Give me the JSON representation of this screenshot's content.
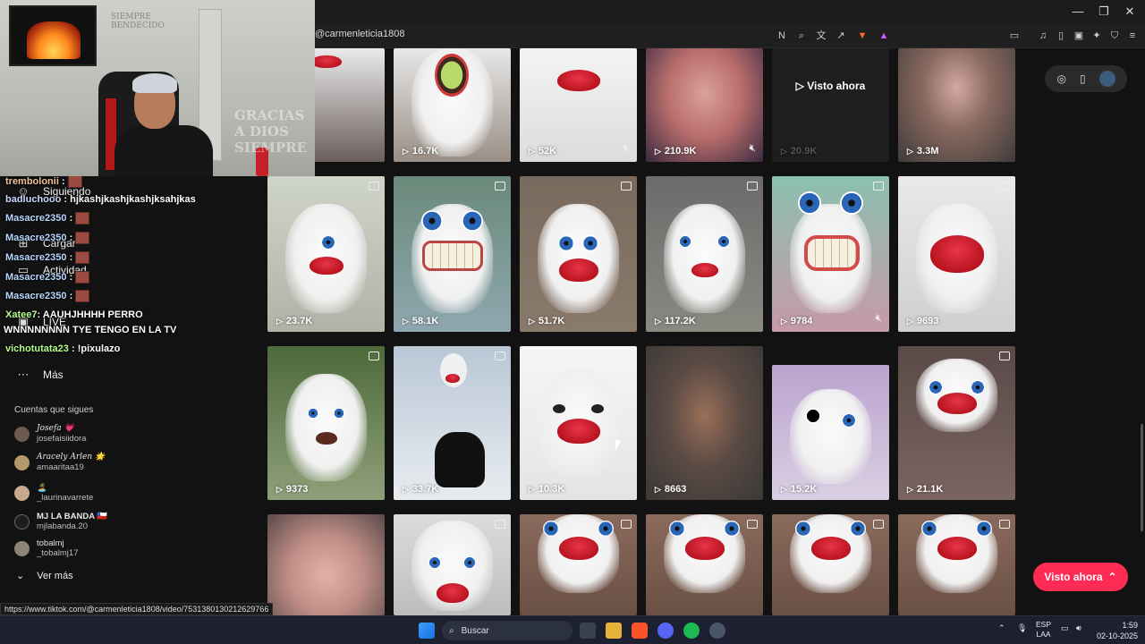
{
  "browser": {
    "url": "@carmenleticia1808",
    "status_url": "https://www.tiktok.com/@carmenleticia1808/video/7531380130212629766"
  },
  "sidebar": {
    "items": [
      {
        "label": "Siguiendo",
        "icon": "following-icon"
      },
      {
        "label": "Cargar",
        "icon": "upload-icon"
      },
      {
        "label": "Actividad",
        "icon": "activity-icon"
      },
      {
        "label": "LIVE",
        "icon": "live-icon"
      },
      {
        "label": "Más",
        "icon": "more-icon"
      }
    ],
    "follows_title": "Cuentas que sigues",
    "follows": [
      {
        "name": "Josefa 💗",
        "user": "josefaisiidora"
      },
      {
        "name": "Aracely Arlen 🌟",
        "user": "amaaritaa19"
      },
      {
        "name": "🏝️",
        "user": "_laurinavarrete"
      },
      {
        "name": "MJ LA BANDA 🇨🇱",
        "user": "mjlabanda.20"
      },
      {
        "name": "tobalmj",
        "user": "_tobalmj17"
      }
    ],
    "ver_mas": "Ver más"
  },
  "chat": [
    {
      "user": "trembolonii",
      "text": ":"
    },
    {
      "user": "badluchooo",
      "text": ": hjkashjkashjkashjksahjkas"
    },
    {
      "user": "Masacre2350",
      "text": ":"
    },
    {
      "user": "Masacre2350",
      "text": ":"
    },
    {
      "user": "Masacre2350",
      "text": ":"
    },
    {
      "user": "Masacre2350",
      "text": ":"
    },
    {
      "user": "Masacre2350",
      "text": ":"
    },
    {
      "user": "Xatee7",
      "text": ": AAUHJHHHH PERRO"
    },
    {
      "user": "",
      "text": "WNNNNNNNN TYE TENGO EN LA TV"
    },
    {
      "user": "vichotutata23",
      "text": ": !pixulazo"
    }
  ],
  "webcam": {
    "wall_text": "GRACIAS A DIOS SIEMPRE"
  },
  "grid": {
    "row1": [
      {
        "views": "",
        "muted": false
      },
      {
        "views": "16.7K",
        "muted": false
      },
      {
        "views": "52K",
        "muted": true
      },
      {
        "views": "210.9K",
        "muted": true
      },
      {
        "views": "20.9K",
        "muted": false,
        "overlay": "Visto ahora"
      },
      {
        "views": "3.3M",
        "muted": false
      }
    ],
    "row2": [
      {
        "views": "23.7K",
        "muted": false
      },
      {
        "views": "58.1K",
        "muted": false
      },
      {
        "views": "51.7K",
        "muted": false
      },
      {
        "views": "117.2K",
        "muted": false
      },
      {
        "views": "9784",
        "muted": true
      },
      {
        "views": "9693",
        "muted": false
      }
    ],
    "row3": [
      {
        "views": "9373",
        "muted": false
      },
      {
        "views": "33.7K",
        "muted": false
      },
      {
        "views": "10.3K",
        "muted": false
      },
      {
        "views": "8663",
        "muted": false
      },
      {
        "views": "15.2K",
        "muted": false
      },
      {
        "views": "21.1K",
        "muted": false
      }
    ]
  },
  "visto_ahora_button": "Visto ahora",
  "taskbar": {
    "search": "Buscar",
    "lang_top": "ESP",
    "lang_bottom": "LAA",
    "time": "1:59",
    "date": "02-10-2025"
  }
}
